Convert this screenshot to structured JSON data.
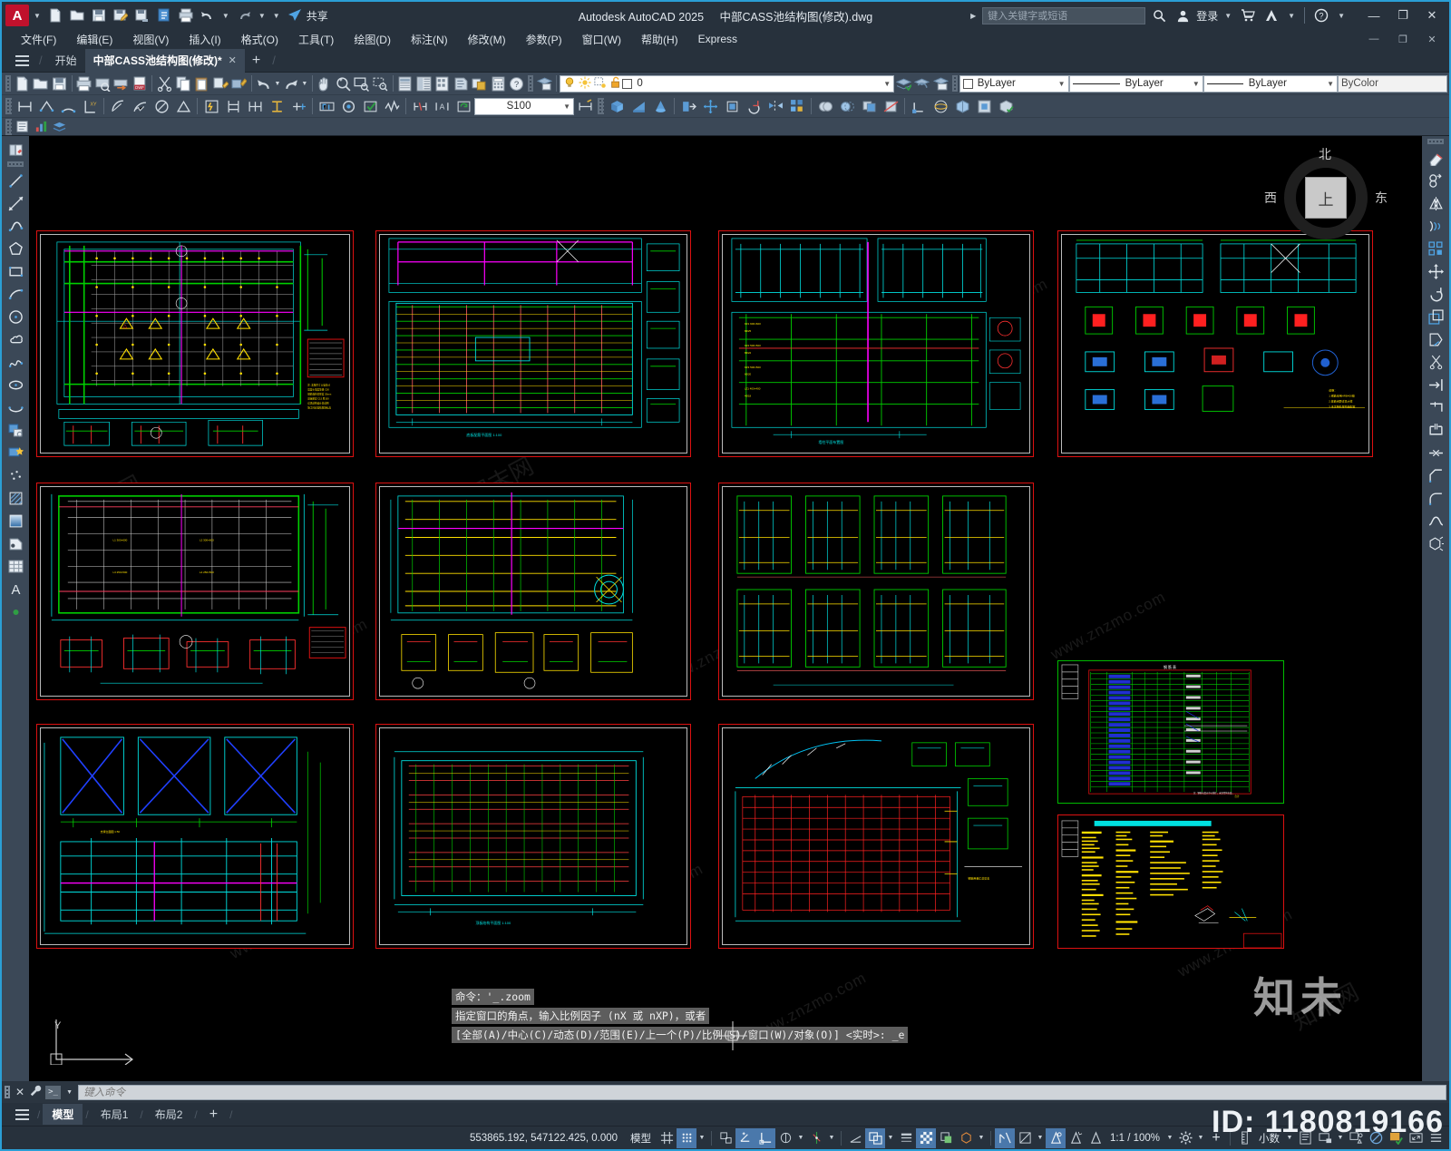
{
  "window": {
    "app_title": "Autodesk AutoCAD 2025",
    "file_title": "中部CASS池结构图(修改).dwg",
    "share_label": "共享",
    "search_placeholder": "键入关键字或短语",
    "signin_label": "登录",
    "minimize": "—",
    "restore": "❐",
    "close": "✕"
  },
  "menu": {
    "items": [
      {
        "label": "文件(F)"
      },
      {
        "label": "编辑(E)"
      },
      {
        "label": "视图(V)"
      },
      {
        "label": "插入(I)"
      },
      {
        "label": "格式(O)"
      },
      {
        "label": "工具(T)"
      },
      {
        "label": "绘图(D)"
      },
      {
        "label": "标注(N)"
      },
      {
        "label": "修改(M)"
      },
      {
        "label": "参数(P)"
      },
      {
        "label": "窗口(W)"
      },
      {
        "label": "帮助(H)"
      },
      {
        "label": "Express"
      }
    ]
  },
  "tabs": {
    "start_label": "开始",
    "file_tab_label": "中部CASS池结构图(修改)*",
    "close_glyph": "✕",
    "new_tab_glyph": "+"
  },
  "toolbar": {
    "layer_current": "0",
    "layer_color_swatch": "#ffffff",
    "scale_value": "S100",
    "prop_color": "ByLayer",
    "prop_linetype": "ByLayer",
    "prop_lineweight": "ByLayer",
    "prop_plotstyle": "ByColor"
  },
  "viewcube": {
    "face": "上",
    "north": "北",
    "west": "西",
    "east": "东"
  },
  "command_history": [
    "命令：'_.zoom",
    "指定窗口的角点，输入比例因子 (nX 或 nXP)，或者",
    "[全部(A)/中心(C)/动态(D)/范围(E)/上一个(P)/比例(S)/窗口(W)/对象(O)] <实时>: _e"
  ],
  "command_input": {
    "placeholder": "键入命令",
    "prompt_glyph": "〉_"
  },
  "ucs": {
    "label": "Y"
  },
  "layout_tabs": {
    "items": [
      {
        "label": "模型",
        "active": true
      },
      {
        "label": "布局1",
        "active": false
      },
      {
        "label": "布局2",
        "active": false
      }
    ],
    "add_glyph": "+"
  },
  "status_bar": {
    "coordinates": "553865.192, 547122.425, 0.000",
    "space_label": "模型",
    "annotation_scale": "1:1 / 100%",
    "units": "小数",
    "add_glyph": "+"
  },
  "watermarks": {
    "site_text": "www.znzmo.com",
    "brand_cn": "知未",
    "brand_cn_small": "知末网",
    "id_label": "ID: 1180819166"
  }
}
